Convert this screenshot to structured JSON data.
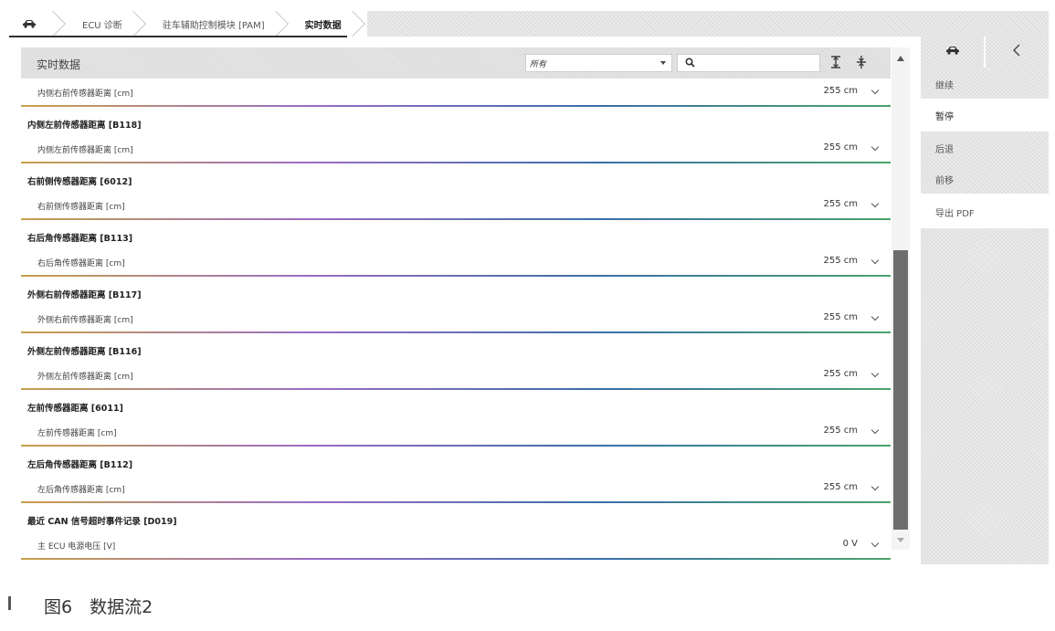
{
  "breadcrumb": {
    "items": [
      "ECU 诊断",
      "驻车辅助控制模块 [PAM]",
      "实时数据"
    ],
    "home_icon": "car-icon"
  },
  "panel": {
    "title": "实时数据",
    "filter_value": "所有",
    "search_value": ""
  },
  "rows": [
    {
      "type": "item",
      "label": "内侧右前传感器距离 [cm]",
      "value": "255 cm"
    },
    {
      "type": "group",
      "label": "内侧左前传感器距离 [B118]"
    },
    {
      "type": "item",
      "label": "内侧左前传感器距离 [cm]",
      "value": "255 cm"
    },
    {
      "type": "group",
      "label": "右前侧传感器距离 [6012]"
    },
    {
      "type": "item",
      "label": "右前侧传感器距离 [cm]",
      "value": "255 cm"
    },
    {
      "type": "group",
      "label": "右后角传感器距离 [B113]"
    },
    {
      "type": "item",
      "label": "右后角传感器距离 [cm]",
      "value": "255 cm"
    },
    {
      "type": "group",
      "label": "外侧右前传感器距离 [B117]"
    },
    {
      "type": "item",
      "label": "外侧右前传感器距离 [cm]",
      "value": "255 cm"
    },
    {
      "type": "group",
      "label": "外侧左前传感器距离 [B116]"
    },
    {
      "type": "item",
      "label": "外侧左前传感器距离 [cm]",
      "value": "255 cm"
    },
    {
      "type": "group",
      "label": "左前传感器距离 [6011]"
    },
    {
      "type": "item",
      "label": "左前传感器距离 [cm]",
      "value": "255 cm"
    },
    {
      "type": "group",
      "label": "左后角传感器距离 [B112]"
    },
    {
      "type": "item",
      "label": "左后角传感器距离 [cm]",
      "value": "255 cm"
    },
    {
      "type": "group",
      "label": "最近 CAN 信号超时事件记录 [D019]"
    },
    {
      "type": "item",
      "label": "主 ECU 电源电压 [V]",
      "value": "0 V"
    }
  ],
  "side": {
    "items": [
      "继续",
      "暂停",
      "后退",
      "前移",
      "导出 PDF"
    ],
    "active_index": 1
  },
  "caption": "图6　数据流2"
}
